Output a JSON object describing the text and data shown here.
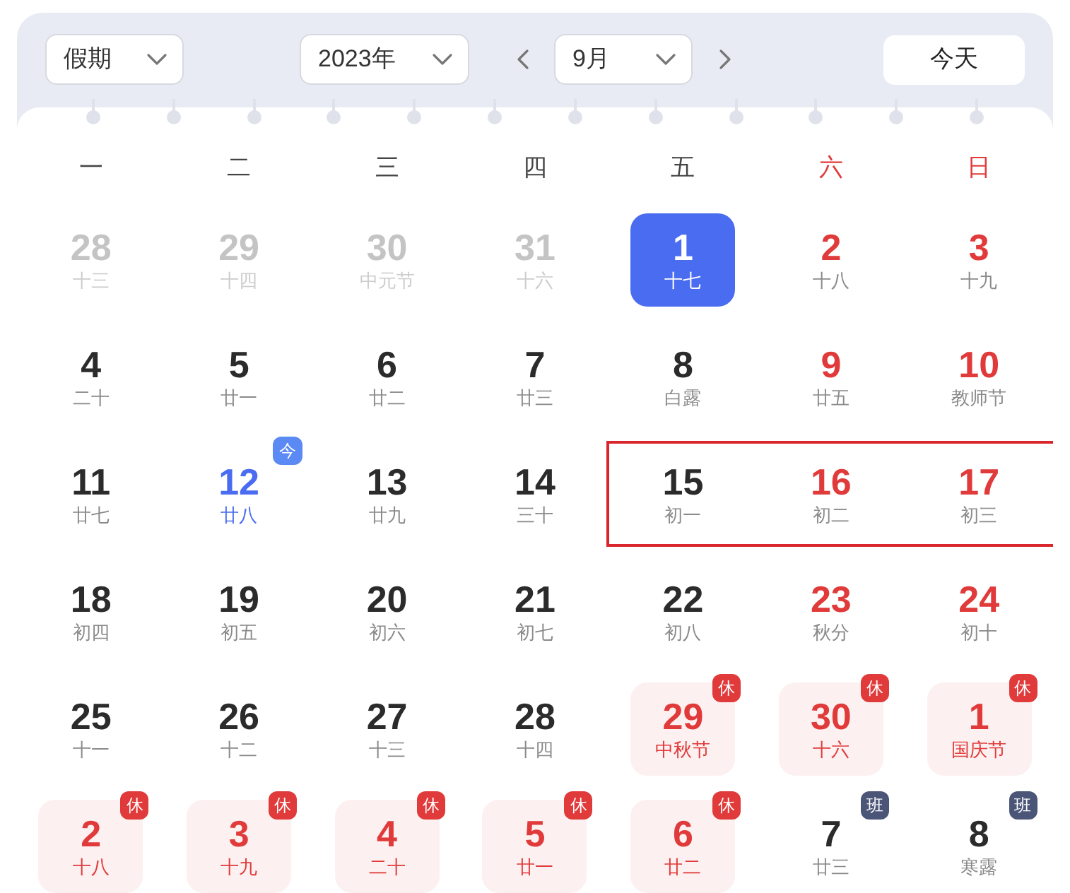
{
  "toolbar": {
    "holiday_select": "假期",
    "year_select": "2023年",
    "month_select": "9月",
    "today_button": "今天"
  },
  "weekdays": [
    {
      "label": "一",
      "weekend": false
    },
    {
      "label": "二",
      "weekend": false
    },
    {
      "label": "三",
      "weekend": false
    },
    {
      "label": "四",
      "weekend": false
    },
    {
      "label": "五",
      "weekend": false
    },
    {
      "label": "六",
      "weekend": true
    },
    {
      "label": "日",
      "weekend": true
    }
  ],
  "weeks": [
    {
      "days": [
        {
          "day": "28",
          "lunar": "十三",
          "kind": "other_month"
        },
        {
          "day": "29",
          "lunar": "十四",
          "kind": "other_month"
        },
        {
          "day": "30",
          "lunar": "中元节",
          "kind": "other_month"
        },
        {
          "day": "31",
          "lunar": "十六",
          "kind": "other_month"
        },
        {
          "day": "1",
          "lunar": "十七",
          "kind": "weekday",
          "selected": true
        },
        {
          "day": "2",
          "lunar": "十八",
          "kind": "red"
        },
        {
          "day": "3",
          "lunar": "十九",
          "kind": "red"
        }
      ]
    },
    {
      "days": [
        {
          "day": "4",
          "lunar": "二十",
          "kind": "weekday"
        },
        {
          "day": "5",
          "lunar": "廿一",
          "kind": "weekday"
        },
        {
          "day": "6",
          "lunar": "廿二",
          "kind": "weekday"
        },
        {
          "day": "7",
          "lunar": "廿三",
          "kind": "weekday"
        },
        {
          "day": "8",
          "lunar": "白露",
          "kind": "weekday"
        },
        {
          "day": "9",
          "lunar": "廿五",
          "kind": "red"
        },
        {
          "day": "10",
          "lunar": "教师节",
          "kind": "red"
        }
      ]
    },
    {
      "days": [
        {
          "day": "11",
          "lunar": "廿七",
          "kind": "weekday"
        },
        {
          "day": "12",
          "lunar": "廿八",
          "kind": "weekday",
          "today": "今"
        },
        {
          "day": "13",
          "lunar": "廿九",
          "kind": "weekday"
        },
        {
          "day": "14",
          "lunar": "三十",
          "kind": "weekday"
        },
        {
          "day": "15",
          "lunar": "初一",
          "kind": "weekday",
          "outlined": true
        },
        {
          "day": "16",
          "lunar": "初二",
          "kind": "red",
          "outlined": true
        },
        {
          "day": "17",
          "lunar": "初三",
          "kind": "red",
          "outlined": true
        }
      ]
    },
    {
      "days": [
        {
          "day": "18",
          "lunar": "初四",
          "kind": "weekday"
        },
        {
          "day": "19",
          "lunar": "初五",
          "kind": "weekday"
        },
        {
          "day": "20",
          "lunar": "初六",
          "kind": "weekday"
        },
        {
          "day": "21",
          "lunar": "初七",
          "kind": "weekday"
        },
        {
          "day": "22",
          "lunar": "初八",
          "kind": "weekday"
        },
        {
          "day": "23",
          "lunar": "秋分",
          "kind": "red"
        },
        {
          "day": "24",
          "lunar": "初十",
          "kind": "red"
        }
      ]
    },
    {
      "days": [
        {
          "day": "25",
          "lunar": "十一",
          "kind": "weekday"
        },
        {
          "day": "26",
          "lunar": "十二",
          "kind": "weekday"
        },
        {
          "day": "27",
          "lunar": "十三",
          "kind": "weekday"
        },
        {
          "day": "28",
          "lunar": "十四",
          "kind": "weekday"
        },
        {
          "day": "29",
          "lunar": "中秋节",
          "kind": "rest",
          "badge": "休"
        },
        {
          "day": "30",
          "lunar": "十六",
          "kind": "rest",
          "badge": "休"
        },
        {
          "day": "1",
          "lunar": "国庆节",
          "kind": "rest",
          "badge": "休"
        }
      ]
    },
    {
      "days": [
        {
          "day": "2",
          "lunar": "十八",
          "kind": "rest",
          "badge": "休"
        },
        {
          "day": "3",
          "lunar": "十九",
          "kind": "rest",
          "badge": "休"
        },
        {
          "day": "4",
          "lunar": "二十",
          "kind": "rest",
          "badge": "休"
        },
        {
          "day": "5",
          "lunar": "廿一",
          "kind": "rest",
          "badge": "休"
        },
        {
          "day": "6",
          "lunar": "廿二",
          "kind": "rest",
          "badge": "休"
        },
        {
          "day": "7",
          "lunar": "廿三",
          "kind": "workday",
          "badge": "班"
        },
        {
          "day": "8",
          "lunar": "寒露",
          "kind": "workday",
          "badge": "班"
        }
      ]
    }
  ]
}
